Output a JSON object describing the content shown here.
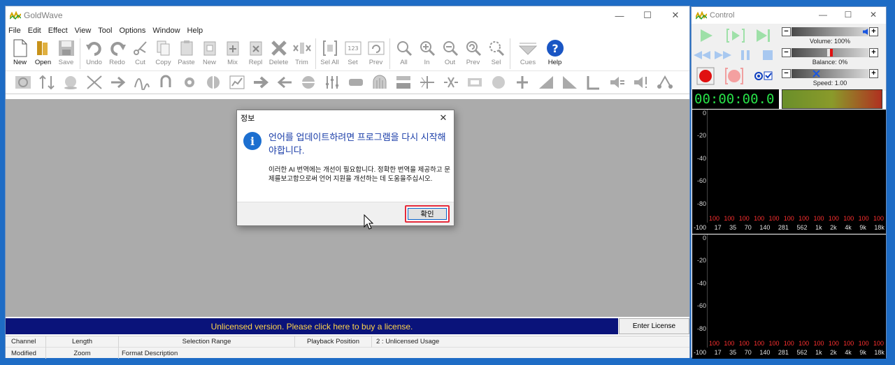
{
  "main": {
    "title": "GoldWave",
    "menu": [
      "File",
      "Edit",
      "Effect",
      "View",
      "Tool",
      "Options",
      "Window",
      "Help"
    ],
    "toolbar": {
      "new": "New",
      "open": "Open",
      "save": "Save",
      "undo": "Undo",
      "redo": "Redo",
      "cut": "Cut",
      "copy": "Copy",
      "paste": "Paste",
      "new2": "New",
      "mix": "Mix",
      "repl": "Repl",
      "delete": "Delete",
      "trim": "Trim",
      "sel_all": "Sel All",
      "set": "Set",
      "prev": "Prev",
      "all": "All",
      "in": "In",
      "out": "Out",
      "prev2": "Prev",
      "sel": "Sel",
      "cues": "Cues",
      "help": "Help"
    },
    "license_banner": "Unlicensed version. Please click here to buy a license.",
    "enter_license": "Enter License",
    "status": {
      "row1": [
        "Channel",
        "Length",
        "Selection Range",
        "Playback Position",
        "2 : Unlicensed Usage"
      ],
      "row2": [
        "Modified",
        "Zoom",
        "Format Description"
      ]
    }
  },
  "dialog": {
    "title": "정보",
    "heading": "언어를 업데이트하려면 프로그램을 다시 시작해야합니다.",
    "message": "이러한 AI 번역에는 개선이 필요합니다. 정확한 번역을 제공하고 문제를보고함으로써 언어 지원을 개선하는 데 도움을주십시오.",
    "ok": "확인"
  },
  "control": {
    "title": "Control",
    "volume_label": "Volume: 100%",
    "volume": 100,
    "balance_label": "Balance: 0%",
    "balance": 0,
    "speed_label": "Speed: 1.00",
    "speed": 1.0,
    "time": "00:00:00.0",
    "spectrum": {
      "y_ticks": [
        "0",
        "-20",
        "-40",
        "-60",
        "-80",
        "-100"
      ],
      "values": [
        "100",
        "100",
        "100",
        "100",
        "100",
        "100",
        "100",
        "100",
        "100",
        "100",
        "100",
        "100"
      ],
      "x_ticks": [
        "17",
        "35",
        "70",
        "140",
        "281",
        "562",
        "1k",
        "2k",
        "4k",
        "9k",
        "18k"
      ]
    }
  }
}
